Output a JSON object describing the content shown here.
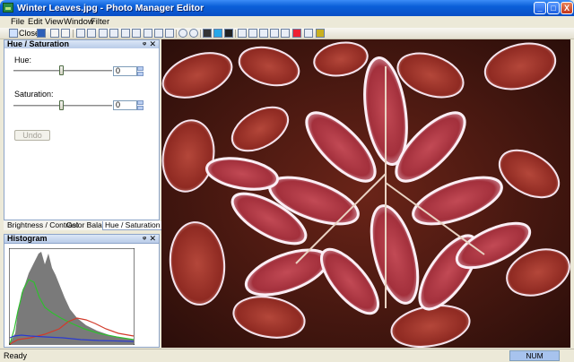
{
  "window": {
    "title": "Winter Leaves.jpg - Photo Manager Editor",
    "minimize": "_",
    "maximize": "□",
    "close": "X"
  },
  "menu": [
    "File",
    "Edit",
    "View",
    "Window",
    "Filter"
  ],
  "toolbar": {
    "close_label": "Close"
  },
  "hue_panel": {
    "title": "Hue / Saturation",
    "pin": "ᵠ",
    "close": "✕",
    "hue_label": "Hue:",
    "hue_value": "0",
    "hue_level": 0,
    "saturation_label": "Saturation:",
    "saturation_value": "0",
    "saturation_level": 0,
    "undo_label": "Undo"
  },
  "tabs": [
    "Brightness / Contrast",
    "Color Balance",
    "Hue / Saturation"
  ],
  "active_tab": "Hue / Saturation",
  "histogram_panel": {
    "title": "Histogram",
    "pin": "ᵠ",
    "close": "✕"
  },
  "status": {
    "ready": "Ready",
    "num": "NUM"
  },
  "colors": {
    "title_bar": "#0a5fd8",
    "frost": "#f2d9e6",
    "leaf_red": "#b33a45",
    "leaf_dark": "#5a1612",
    "histogram_gray": "#6b6b6b",
    "histogram_green": "#2fbf2f",
    "histogram_red": "#d23a2a",
    "histogram_blue": "#2a3ad0"
  }
}
